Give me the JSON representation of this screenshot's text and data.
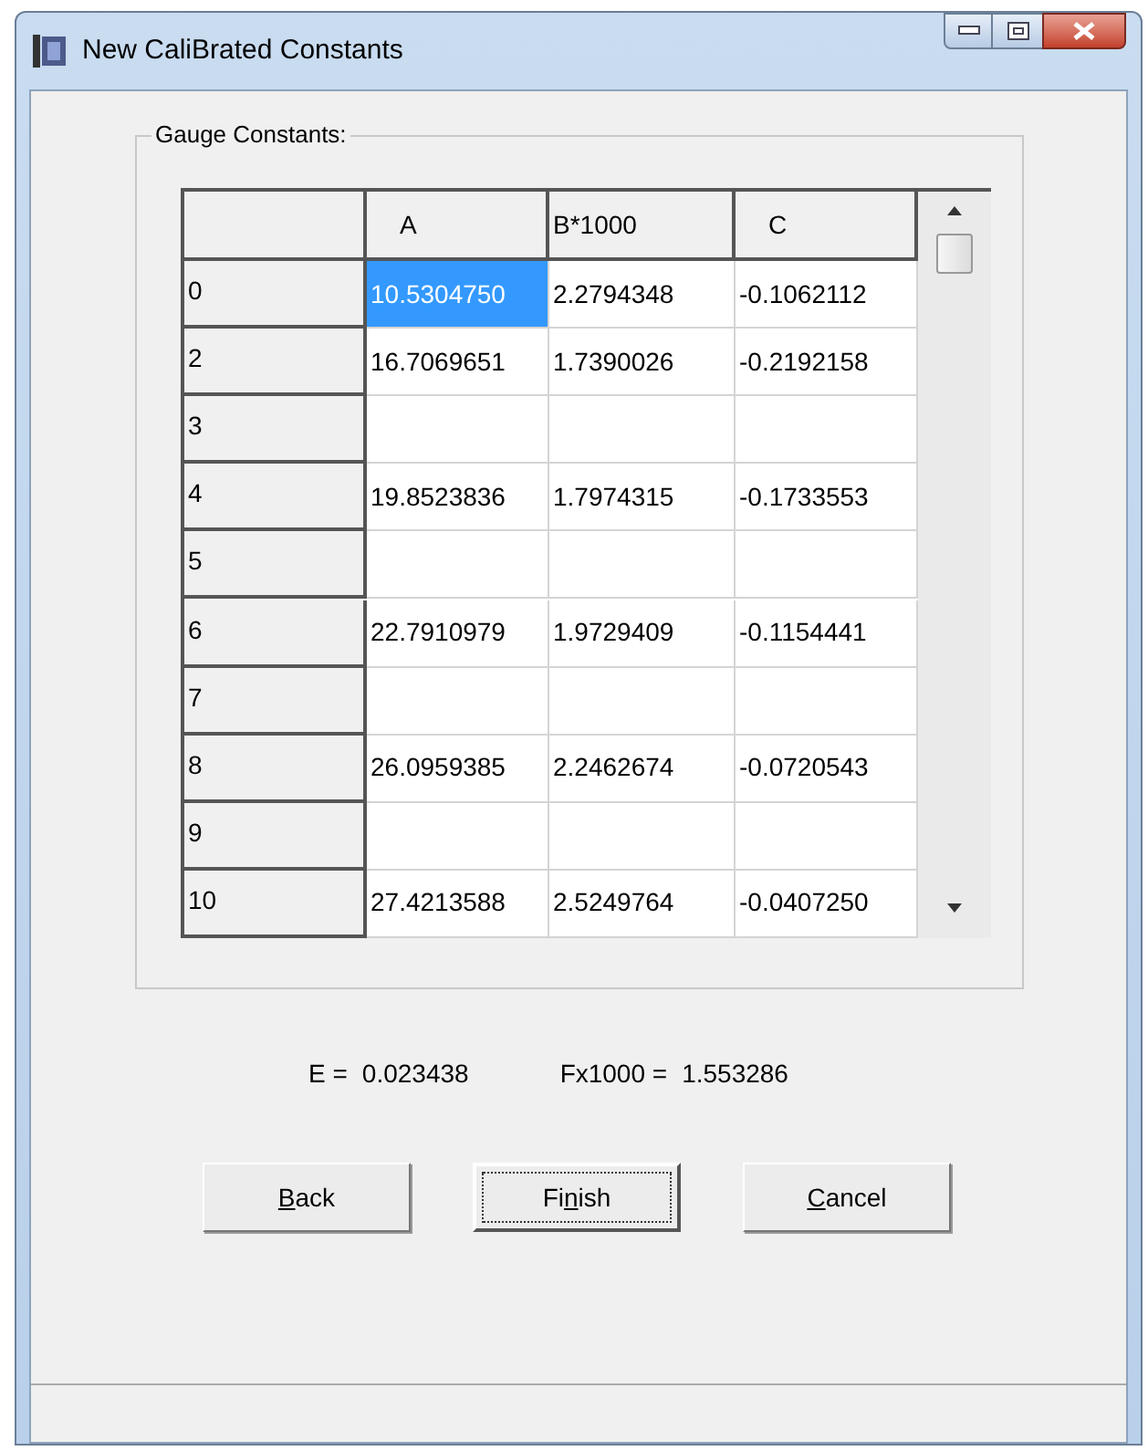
{
  "window": {
    "title": "New CaliBrated Constants"
  },
  "group": {
    "label": "Gauge Constants:"
  },
  "table": {
    "columns": [
      "A",
      "B*1000",
      "C"
    ],
    "rows": [
      {
        "header": "0",
        "cells": [
          {
            "text": "10.5304750",
            "selected": true
          },
          {
            "text": "2.2794348",
            "selected": false
          },
          {
            "text": "-0.1062112",
            "selected": false
          }
        ]
      },
      {
        "header": "2",
        "cells": [
          {
            "text": "16.7069651",
            "selected": false
          },
          {
            "text": "1.7390026",
            "selected": false
          },
          {
            "text": "-0.2192158",
            "selected": false
          }
        ]
      },
      {
        "header": "3",
        "cells": [
          {
            "selected": false
          },
          {
            "selected": false
          },
          {
            "selected": false
          }
        ]
      },
      {
        "header": "4",
        "cells": [
          {
            "text": "19.8523836",
            "selected": false
          },
          {
            "text": "1.7974315",
            "selected": false
          },
          {
            "text": "-0.1733553",
            "selected": false
          }
        ]
      },
      {
        "header": "5",
        "cells": [
          {
            "selected": false
          },
          {
            "selected": false
          },
          {
            "selected": false
          }
        ]
      },
      {
        "header": "6",
        "cells": [
          {
            "text": "22.7910979",
            "selected": false
          },
          {
            "text": "1.9729409",
            "selected": false
          },
          {
            "text": "-0.1154441",
            "selected": false
          }
        ]
      },
      {
        "header": "7",
        "cells": [
          {
            "selected": false
          },
          {
            "selected": false
          },
          {
            "selected": false
          }
        ]
      },
      {
        "header": "8",
        "cells": [
          {
            "text": "26.0959385",
            "selected": false
          },
          {
            "text": "2.2462674",
            "selected": false
          },
          {
            "text": "-0.0720543",
            "selected": false
          }
        ]
      },
      {
        "header": "9",
        "cells": [
          {
            "selected": false
          },
          {
            "selected": false
          },
          {
            "selected": false
          }
        ]
      },
      {
        "header": "10",
        "cells": [
          {
            "text": "27.4213588",
            "selected": false
          },
          {
            "text": "2.5249764",
            "selected": false
          },
          {
            "text": "-0.0407250",
            "selected": false
          }
        ]
      }
    ]
  },
  "readouts": [
    {
      "label": "E =",
      "value": "0.023438"
    },
    {
      "label": "Fx1000 =",
      "value": "1.553286"
    }
  ],
  "buttons": [
    {
      "access_key": "B",
      "label_rest": "ack",
      "default": false
    },
    {
      "label_start": "Fi",
      "access_key": "n",
      "label_rest": "ish",
      "default": true
    },
    {
      "access_key": "C",
      "label_rest": "ancel",
      "default": false
    }
  ]
}
